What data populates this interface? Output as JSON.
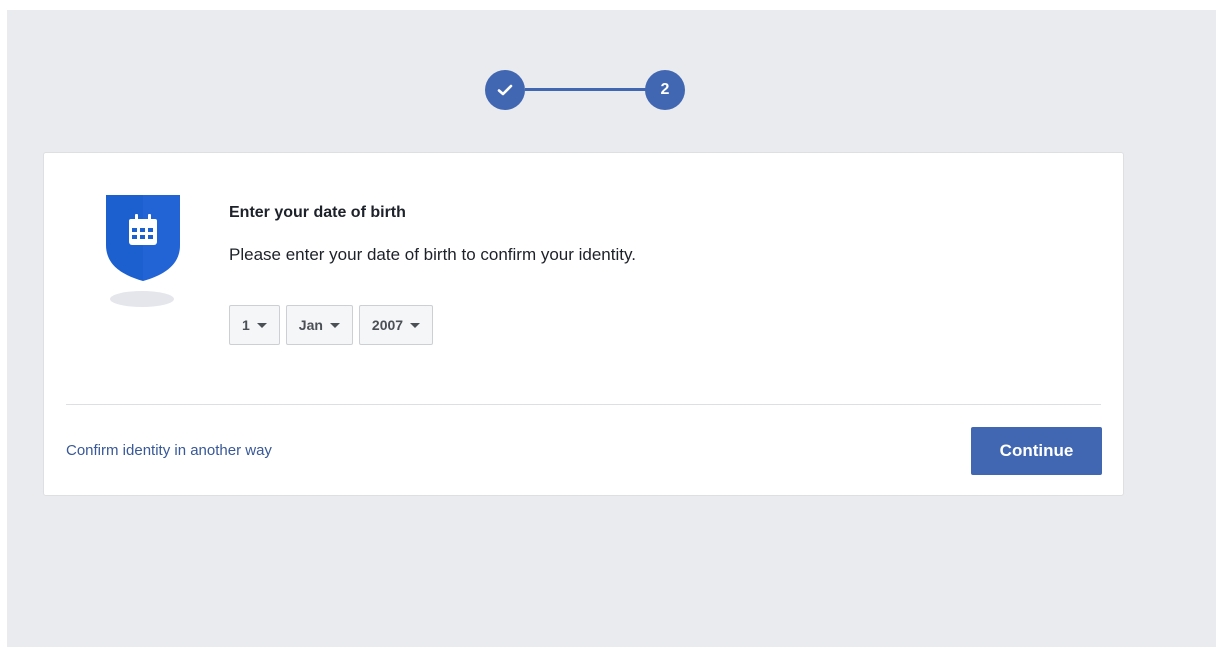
{
  "stepper": {
    "step1_icon": "checkmark-icon",
    "step2_label": "2",
    "accent": "#4267b2"
  },
  "card": {
    "icon": "shield-calendar-icon",
    "title": "Enter your date of birth",
    "subtitle": "Please enter your date of birth to confirm your identity.",
    "day_value": "1",
    "month_value": "Jan",
    "year_value": "2007",
    "alt_link": "Confirm identity in another way",
    "continue_label": "Continue"
  }
}
